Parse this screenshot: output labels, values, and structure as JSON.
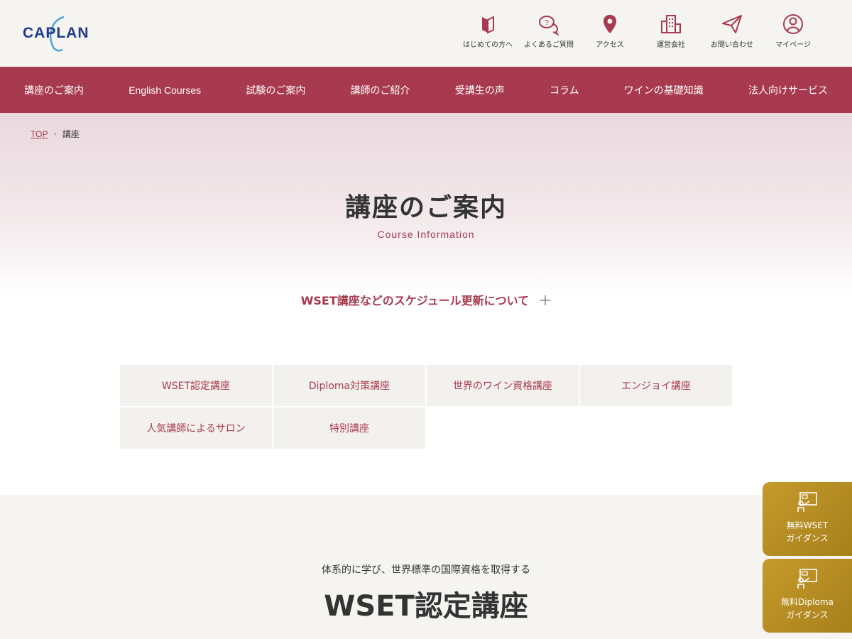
{
  "header": {
    "logo_text": "CAPLAN",
    "utility_nav": [
      {
        "label": "はじめての方へ",
        "icon": "beginner-mark-icon"
      },
      {
        "label": "よくあるご質問",
        "icon": "faq-bubble-icon"
      },
      {
        "label": "アクセス",
        "icon": "map-pin-icon"
      },
      {
        "label": "運営会社",
        "icon": "building-icon"
      },
      {
        "label": "お問い合わせ",
        "icon": "paper-plane-icon"
      },
      {
        "label": "マイページ",
        "icon": "user-circle-icon"
      }
    ]
  },
  "main_nav": [
    {
      "label": "講座のご案内"
    },
    {
      "label": "English Courses"
    },
    {
      "label": "試験のご案内"
    },
    {
      "label": "講師のご紹介"
    },
    {
      "label": "受講生の声"
    },
    {
      "label": "コラム"
    },
    {
      "label": "ワインの基礎知識"
    },
    {
      "label": "法人向けサービス"
    }
  ],
  "breadcrumb": {
    "top": "TOP",
    "current": "講座"
  },
  "hero": {
    "title": "講座のご案内",
    "subtitle": "Course Information"
  },
  "schedule_notice": {
    "label": "WSET講座などのスケジュール更新について",
    "icon": "plus-icon"
  },
  "categories": [
    {
      "label": "WSET認定講座"
    },
    {
      "label": "Diploma対策講座"
    },
    {
      "label": "世界のワイン資格講座"
    },
    {
      "label": "エンジョイ講座"
    },
    {
      "label": "人気講師によるサロン"
    },
    {
      "label": "特別講座"
    }
  ],
  "section": {
    "lead": "体系的に学び、世界標準の国際資格を取得する",
    "title": "WSET認定講座"
  },
  "floating_buttons": [
    {
      "line1": "無料WSET",
      "line2": "ガイダンス",
      "icon": "presentation-board-icon"
    },
    {
      "line1": "無料Diploma",
      "line2": "ガイダンス",
      "icon": "presentation-board-icon"
    }
  ],
  "colors": {
    "brand": "#a83a4f",
    "logo_blue": "#1e3a8a",
    "gold": "#b68c22",
    "header_bg": "#f5f4f1"
  }
}
